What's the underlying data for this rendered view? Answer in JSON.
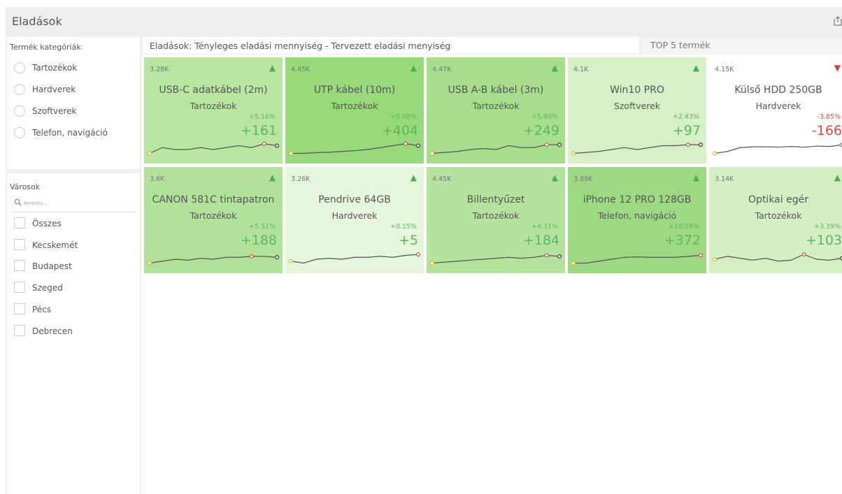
{
  "app": {
    "title": "Eladások"
  },
  "sidebar": {
    "categories_title": "Termék kategóriák",
    "categories": [
      "Tartozékok",
      "Hardverek",
      "Szoftverek",
      "Telefon, navigáció"
    ],
    "cities_title": "Városok",
    "search_placeholder": "Keresés...",
    "cities": [
      "Összes",
      "Kecskemét",
      "Budapest",
      "Szeged",
      "Pécs",
      "Debrecen"
    ]
  },
  "main": {
    "tab_label": "Eladások: Tényleges eladási mennyiség - Tervezett eladási menyiség",
    "top5_label": "TOP 5 termék"
  },
  "colors": {
    "green_text": "#5cb85c",
    "red_text": "#e04848",
    "green_triangle": "#4caf50",
    "red_triangle": "#e53935"
  },
  "cards": [
    {
      "value": "3.28K",
      "name": "USB-C adatkábel (2m)",
      "category": "Tartozékok",
      "pct": "+5.16%",
      "delta": "+161",
      "trend": "up",
      "bg": "#b8e6a0",
      "spark": [
        2,
        5,
        4,
        4,
        5,
        4,
        5,
        6,
        5,
        7,
        6
      ]
    },
    {
      "value": "4.45K",
      "name": "UTP kábel (10m)",
      "category": "Tartozékok",
      "pct": "+9.98%",
      "delta": "+404",
      "trend": "up",
      "bg": "#98d97c",
      "spark": [
        2,
        2,
        2.4,
        2.6,
        3,
        3.4,
        4,
        5,
        6,
        7,
        6
      ]
    },
    {
      "value": "4.47K",
      "name": "USB A-B kábel (3m)",
      "category": "Tartozékok",
      "pct": "+5.90%",
      "delta": "+249",
      "trend": "up",
      "bg": "#a7de8e",
      "spark": [
        2,
        2.5,
        3,
        4,
        4.5,
        4,
        6,
        5,
        5,
        6.5,
        6.5
      ]
    },
    {
      "value": "4.1K",
      "name": "Win10 PRO",
      "category": "Szoftverek",
      "pct": "+2.43%",
      "delta": "+97",
      "trend": "up",
      "bg": "#d5f0c6",
      "spark": [
        2,
        2.5,
        3,
        4,
        5,
        4,
        5,
        6,
        6,
        6.5,
        6.5
      ]
    },
    {
      "value": "4.15K",
      "name": "Külső HDD 250GB",
      "category": "Hardverek",
      "pct": "-3.85%",
      "delta": "-166",
      "trend": "down",
      "bg": "#ffffff",
      "spark": [
        2,
        3,
        5,
        5.4,
        5.4,
        5.3,
        5.6,
        5.2,
        5.8,
        5.6,
        6.4
      ]
    },
    {
      "value": "3.6K",
      "name": "CANON 581C tintapatron",
      "category": "Tartozékok",
      "pct": "+5.51%",
      "delta": "+188",
      "trend": "up",
      "bg": "#b1e29a",
      "spark": [
        2,
        3,
        4,
        3.5,
        4.5,
        4,
        5,
        5,
        5.5,
        5.5,
        5
      ]
    },
    {
      "value": "3.26K",
      "name": "Pendrive 64GB",
      "category": "Hardverek",
      "pct": "+0.15%",
      "delta": "+5",
      "trend": "up",
      "bg": "#e6f6dd",
      "spark": [
        3,
        2,
        4,
        4.5,
        4,
        5,
        5,
        5.5,
        5,
        6,
        6.5
      ]
    },
    {
      "value": "4.45K",
      "name": "Billentyűzet",
      "category": "Tartozékok",
      "pct": "+4.31%",
      "delta": "+184",
      "trend": "up",
      "bg": "#b3e39c",
      "spark": [
        2,
        2.5,
        3,
        3.5,
        4,
        4.5,
        5,
        4.5,
        5,
        6,
        5.5
      ]
    },
    {
      "value": "3.89K",
      "name": "iPhone 12 PRO 128GB",
      "category": "Telefon, navigáció",
      "pct": "+10.59%",
      "delta": "+372",
      "trend": "up",
      "bg": "#9dd983",
      "spark": [
        2,
        2,
        3,
        4,
        5,
        5.2,
        5,
        5,
        5,
        5.5,
        6
      ]
    },
    {
      "value": "3.14K",
      "name": "Optikai egér",
      "category": "Tartozékok",
      "pct": "+3.39%",
      "delta": "+103",
      "trend": "up",
      "bg": "#d3efc3",
      "spark": [
        4,
        5.5,
        4.5,
        3.5,
        4.5,
        3,
        3.5,
        6.5,
        4,
        3.5,
        4.5
      ]
    }
  ]
}
